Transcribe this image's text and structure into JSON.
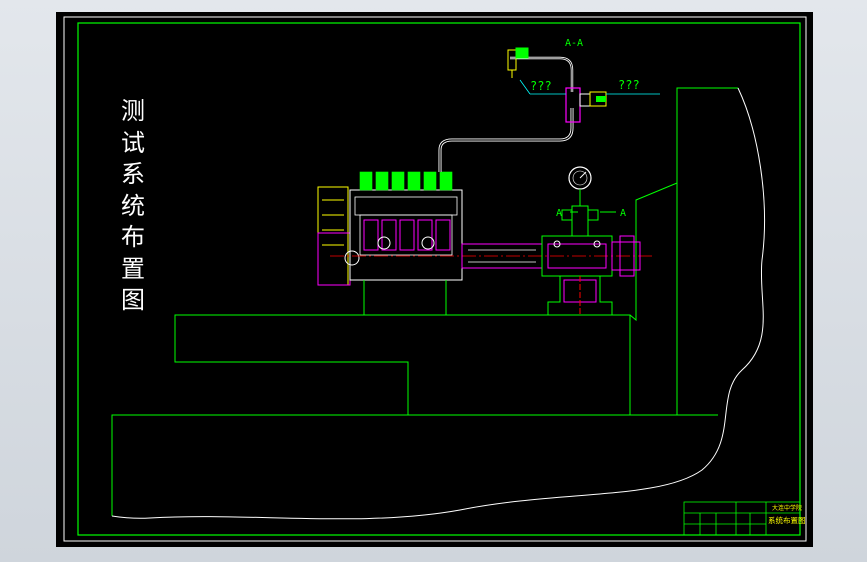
{
  "drawing": {
    "vertical_title": [
      "测",
      "试",
      "系",
      "统",
      "布",
      "置",
      "图"
    ],
    "section_label_top": "A-A",
    "section_label_left": "A",
    "section_label_right": "A",
    "callout_left": "???",
    "callout_right": "???"
  },
  "title_block": {
    "school": "大连中学院",
    "drawing_name": "系统布置图"
  },
  "colors": {
    "sheet_background": "#000000",
    "line_green": "#00ff00",
    "line_white": "#ffffff",
    "magenta": "#ff00ff",
    "cyan": "#00ffff",
    "yellow": "#ffff00",
    "red": "#ff0000"
  }
}
